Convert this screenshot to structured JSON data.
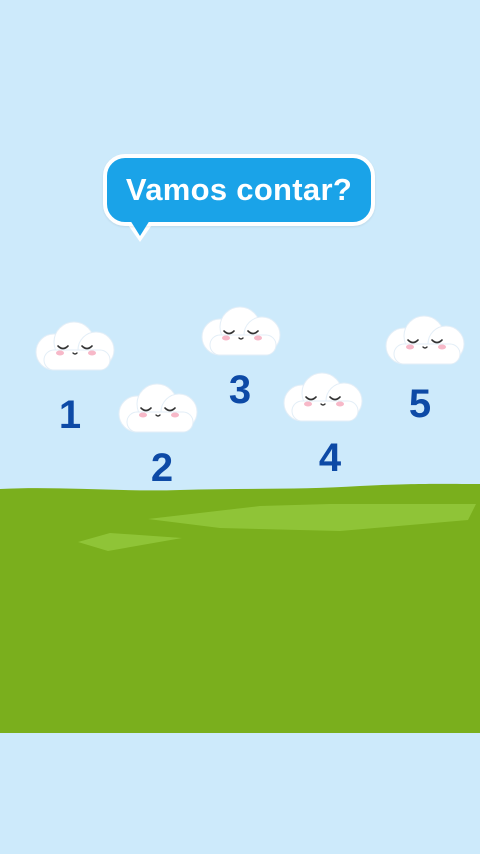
{
  "prompt": {
    "text": "Vamos contar?"
  },
  "numbers": [
    {
      "label": "1"
    },
    {
      "label": "2"
    },
    {
      "label": "3"
    },
    {
      "label": "4"
    },
    {
      "label": "5"
    }
  ],
  "colors": {
    "sky": "#cdeafb",
    "grass": "#7aaf1d",
    "grass_highlight": "#93c83c",
    "bubble": "#1aa3e8",
    "number": "#0d4aa6",
    "cloud": "#ffffff",
    "cheek": "#f7b8c8"
  },
  "icons": {
    "cloud": "smiling-cloud-icon"
  }
}
